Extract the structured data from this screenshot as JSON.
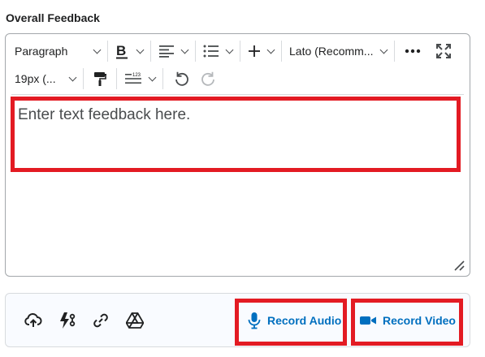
{
  "section": {
    "label": "Overall Feedback"
  },
  "toolbar": {
    "format_block": "Paragraph",
    "font_family": "Lato (Recomm...",
    "font_size": "19px (...",
    "icons": [
      "bold-icon",
      "align-left-icon",
      "bullet-list-icon",
      "insert-plus-icon",
      "more-icon",
      "fullscreen-icon",
      "format-painter-icon",
      "line-spacing-icon",
      "undo-icon",
      "redo-icon"
    ]
  },
  "editor": {
    "placeholder": "Enter text feedback here."
  },
  "attachments": {
    "icons": [
      "upload-cloud-icon",
      "quicklink-icon",
      "link-icon",
      "google-drive-icon"
    ],
    "record_audio": "Record Audio",
    "record_video": "Record Video"
  },
  "colors": {
    "accent": "#006fbf",
    "highlight": "#e31b23",
    "border": "#a3a7ab",
    "text": "#202122"
  }
}
